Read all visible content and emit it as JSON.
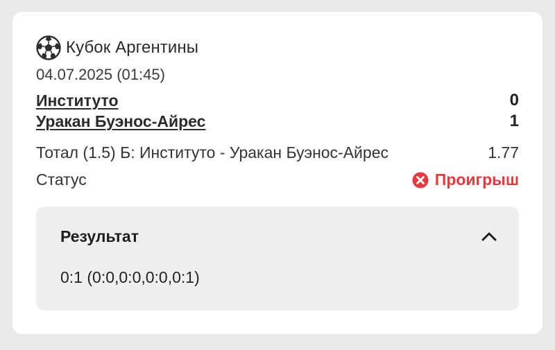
{
  "bet": {
    "tournament": "Кубок Аргентины",
    "tournament_icon": "soccer-ball-icon",
    "date": "04.07.2025 (01:45)",
    "home_team": "Институто",
    "home_score": "0",
    "away_team": "Уракан Буэнос-Айрес",
    "away_score": "1",
    "market": "Тотал (1.5) Б: Институто - Уракан Буэнос-Айрес",
    "odds": "1.77",
    "status_label": "Статус",
    "status_value": "Проигрыш",
    "status_icon": "close-circle-icon",
    "status_color": "#e8383d"
  },
  "result": {
    "title": "Результат",
    "score": "0:1 (0:0,0:0,0:0,0:1)",
    "toggle_icon": "chevron-up-icon"
  },
  "colors": {
    "page_background": "#e9e9e9",
    "card_background": "#ffffff",
    "panel_background": "#efefef",
    "loss_red": "#e8383d"
  }
}
